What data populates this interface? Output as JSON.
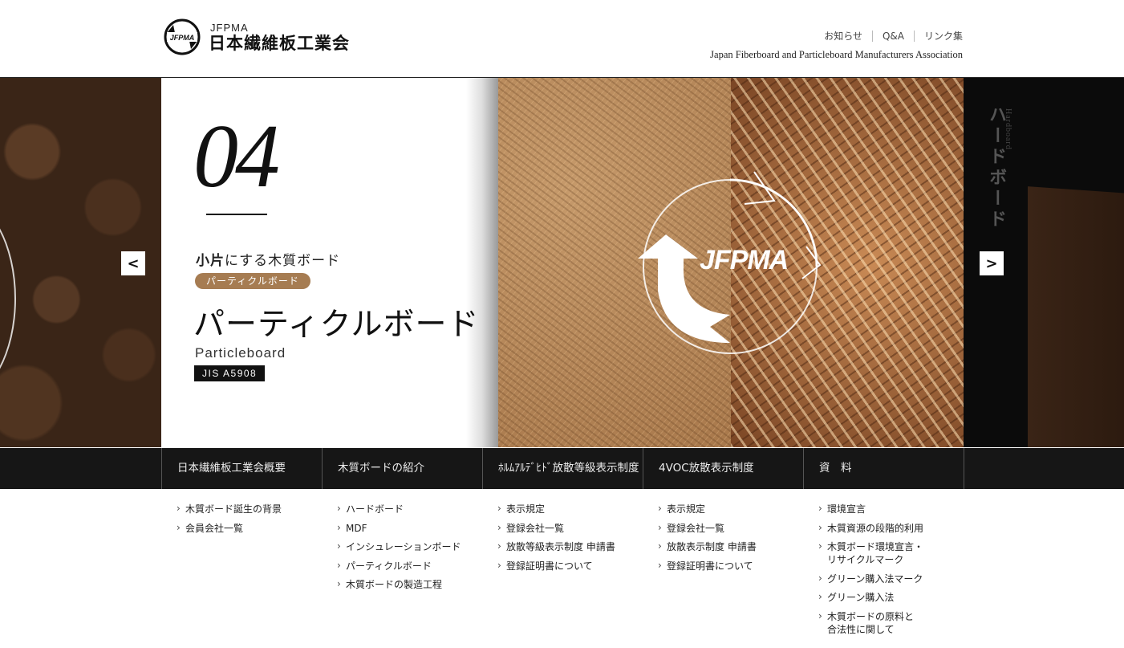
{
  "header": {
    "logo_abbr": "JFPMA",
    "logo_name": "日本繊維板工業会",
    "logo_mark_text": "JFPMA",
    "links": [
      "お知らせ",
      "Q&A",
      "リンク集"
    ],
    "tagline": "Japan Fiberboard and Particleboard Manufacturers Association"
  },
  "hero": {
    "number": "04",
    "catch_strong": "小片",
    "catch_rest": "にする木質ボード",
    "pill": "パーティクルボード",
    "title_ja": "パーティクルボード",
    "title_en": "Particleboard",
    "jis": "JIS A5908",
    "cycle_label": "JFPMA",
    "next_vertical": "ハードボード",
    "next_vertical_en": "Hardboard",
    "prev_arrow": "<",
    "next_arrow": ">"
  },
  "nav": [
    "日本繊維板工業会概要",
    "木質ボードの紹介",
    "ﾎﾙﾑｱﾙﾃﾞﾋﾄﾞ放散等級表示制度",
    "4VOC放散表示制度",
    "資　料"
  ],
  "submenus": [
    [
      "木質ボード誕生の背景",
      "会員会社一覧"
    ],
    [
      "ハードボード",
      "MDF",
      "インシュレーションボード",
      "パーティクルボード",
      "木質ボードの製造工程"
    ],
    [
      "表示規定",
      "登録会社一覧",
      "放散等級表示制度 申請書",
      "登録証明書について"
    ],
    [
      "表示規定",
      "登録会社一覧",
      "放散表示制度 申請書",
      "登録証明書について"
    ],
    [
      "環境宣言",
      "木質資源の段階的利用",
      "木質ボード環境宣言・\nリサイクルマーク",
      "グリーン購入法マーク",
      "グリーン購入法",
      "木質ボードの原料と\n合法性に関して"
    ]
  ]
}
